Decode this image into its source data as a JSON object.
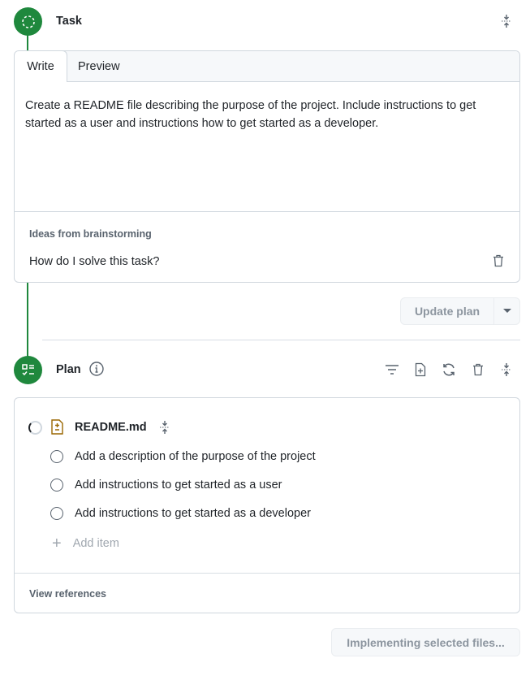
{
  "task": {
    "title": "Task",
    "tabs": [
      {
        "label": "Write",
        "active": true
      },
      {
        "label": "Preview",
        "active": false
      }
    ],
    "text": "Create a README file describing the purpose of the project. Include instructions to get started as a user and instructions how to get started as a developer.",
    "ideas_label": "Ideas from brainstorming",
    "idea": "How do I solve this task?",
    "update_button": "Update plan"
  },
  "plan": {
    "title": "Plan",
    "file": {
      "name": "README.md",
      "status": "in-progress"
    },
    "items": [
      {
        "label": "Add a description of the purpose of the project",
        "checked": false
      },
      {
        "label": "Add instructions to get started as a user",
        "checked": false
      },
      {
        "label": "Add instructions to get started as a developer",
        "checked": false
      }
    ],
    "add_item": "Add item",
    "view_references": "View references",
    "implement_button": "Implementing selected files..."
  },
  "colors": {
    "accent": "#1f883d",
    "file_icon": "#9a6700"
  }
}
